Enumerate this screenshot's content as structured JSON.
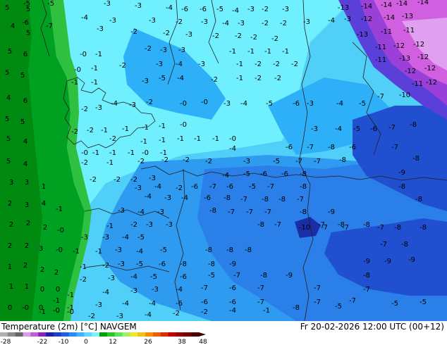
{
  "footer": {
    "title": "Temperature (2m) [°C] NAVGEM",
    "date": "Fr 20-02-2026 12:00 UTC (00+12)"
  },
  "scale": {
    "labels": [
      "-28",
      "-22",
      "-10",
      "0",
      "12",
      "26",
      "38",
      "48"
    ],
    "colors": [
      "#b0b0b0",
      "#8a8a8a",
      "#666666",
      "#d8a0e0",
      "#c060d0",
      "#9020b0",
      "#2020a0",
      "#2040c0",
      "#2060e0",
      "#2a8af0",
      "#40b0ff",
      "#60d8ff",
      "#80f0ff",
      "#00a000",
      "#30c030",
      "#60e060",
      "#a0f060",
      "#e8e830",
      "#f0c020",
      "#f09000",
      "#e86000",
      "#d83000",
      "#c00000",
      "#900000",
      "#700000",
      "#500000"
    ]
  },
  "map": {
    "labels": [
      {
        "t": "-5"
      },
      {
        "t": "-5"
      },
      {
        "t": "-3"
      },
      {
        "t": "-3"
      },
      {
        "t": "-4"
      },
      {
        "t": "-6"
      },
      {
        "t": "-6"
      },
      {
        "t": "-5"
      },
      {
        "t": "-4"
      },
      {
        "t": "-3"
      },
      {
        "t": "-2"
      },
      {
        "t": "-3"
      },
      {
        "t": "-13"
      },
      {
        "t": "-14"
      },
      {
        "t": "-14"
      },
      {
        "t": "-14"
      },
      {
        "t": "-14"
      },
      {
        "t": "-6"
      },
      {
        "t": "-4"
      },
      {
        "t": "-3"
      },
      {
        "t": "-3"
      },
      {
        "t": "-2"
      },
      {
        "t": "-3"
      },
      {
        "t": "-4"
      },
      {
        "t": "-3"
      },
      {
        "t": "-2"
      },
      {
        "t": "-2"
      },
      {
        "t": "-3"
      },
      {
        "t": "-4"
      },
      {
        "t": "-3"
      },
      {
        "t": "-12"
      },
      {
        "t": "-14"
      },
      {
        "t": "-13"
      },
      {
        "t": "-7"
      },
      {
        "t": "-3"
      },
      {
        "t": "-2"
      },
      {
        "t": "-2"
      },
      {
        "t": "-3"
      },
      {
        "t": "-2"
      },
      {
        "t": "-2"
      },
      {
        "t": "-2"
      },
      {
        "t": "-2"
      },
      {
        "t": "-13"
      },
      {
        "t": "-11"
      },
      {
        "t": "-11"
      },
      {
        "t": "-0"
      },
      {
        "t": "-1"
      },
      {
        "t": "-2"
      },
      {
        "t": "-3"
      },
      {
        "t": "-3"
      },
      {
        "t": "-1"
      },
      {
        "t": "-1"
      },
      {
        "t": "-1"
      },
      {
        "t": "-1"
      },
      {
        "t": "-11"
      },
      {
        "t": "-12"
      },
      {
        "t": "-12"
      },
      {
        "t": "-0"
      },
      {
        "t": "-1"
      },
      {
        "t": "-2"
      },
      {
        "t": "-3"
      },
      {
        "t": "-4"
      },
      {
        "t": "-3"
      },
      {
        "t": "-1"
      },
      {
        "t": "-2"
      },
      {
        "t": "-2"
      },
      {
        "t": "-2"
      },
      {
        "t": "-11"
      },
      {
        "t": "-13"
      },
      {
        "t": "-12"
      },
      {
        "t": "-1"
      },
      {
        "t": "-1"
      },
      {
        "t": "-3"
      },
      {
        "t": "-5"
      },
      {
        "t": "-4"
      },
      {
        "t": "-2"
      },
      {
        "t": "-1"
      },
      {
        "t": "-2"
      },
      {
        "t": "-2"
      },
      {
        "t": "-12"
      },
      {
        "t": "-12"
      },
      {
        "t": "-2"
      },
      {
        "t": "-3"
      },
      {
        "t": "-4"
      },
      {
        "t": "-3"
      },
      {
        "t": "-2"
      },
      {
        "t": "-0"
      },
      {
        "t": "-0"
      },
      {
        "t": "-3"
      },
      {
        "t": "-4"
      },
      {
        "t": "-5"
      },
      {
        "t": "-6"
      },
      {
        "t": "-11"
      },
      {
        "t": "-12"
      },
      {
        "t": "-2"
      },
      {
        "t": "-2"
      },
      {
        "t": "-1"
      },
      {
        "t": "-1"
      },
      {
        "t": "-1"
      },
      {
        "t": "-1"
      },
      {
        "t": "-0"
      },
      {
        "t": "-3"
      },
      {
        "t": "-4"
      },
      {
        "t": "-5"
      },
      {
        "t": "-7"
      },
      {
        "t": "-10"
      },
      {
        "t": "-2"
      },
      {
        "t": "-1"
      },
      {
        "t": "-1"
      },
      {
        "t": "-1"
      },
      {
        "t": "-1"
      },
      {
        "t": "-1"
      },
      {
        "t": "-0"
      },
      {
        "t": "-3"
      },
      {
        "t": "-4"
      },
      {
        "t": "-5"
      },
      {
        "t": "-6"
      },
      {
        "t": "-7"
      },
      {
        "t": "-8"
      },
      {
        "t": "-0"
      },
      {
        "t": "-1"
      },
      {
        "t": "-1"
      },
      {
        "t": "-1"
      },
      {
        "t": "-0"
      },
      {
        "t": "-1"
      },
      {
        "t": "-4"
      },
      {
        "t": "-6"
      },
      {
        "t": "-7"
      },
      {
        "t": "-8"
      },
      {
        "t": "-6"
      },
      {
        "t": "-7"
      },
      {
        "t": "-2"
      },
      {
        "t": "-1"
      },
      {
        "t": "-2"
      },
      {
        "t": "-2"
      },
      {
        "t": "-2"
      },
      {
        "t": "-2"
      },
      {
        "t": "-3"
      },
      {
        "t": "-5"
      },
      {
        "t": "-7"
      },
      {
        "t": "-7"
      },
      {
        "t": "-8"
      },
      {
        "t": "-8"
      },
      {
        "t": "-2"
      },
      {
        "t": "-2"
      },
      {
        "t": "-2"
      },
      {
        "t": "-3"
      },
      {
        "t": "-4"
      },
      {
        "t": "-5"
      },
      {
        "t": "-6"
      },
      {
        "t": "-6"
      },
      {
        "t": "-8"
      },
      {
        "t": "-9"
      },
      {
        "t": "-3"
      },
      {
        "t": "-4"
      },
      {
        "t": "-2"
      },
      {
        "t": "-6"
      },
      {
        "t": "-7"
      },
      {
        "t": "-6"
      },
      {
        "t": "-5"
      },
      {
        "t": "-7"
      },
      {
        "t": "-8"
      },
      {
        "t": "-8"
      },
      {
        "t": "-4"
      },
      {
        "t": "-3"
      },
      {
        "t": "-4"
      },
      {
        "t": "-6"
      },
      {
        "t": "-8"
      },
      {
        "t": "-7"
      },
      {
        "t": "-8"
      },
      {
        "t": "-8"
      },
      {
        "t": "-7"
      },
      {
        "t": "-8"
      },
      {
        "t": "-3"
      },
      {
        "t": "-4"
      },
      {
        "t": "-3"
      },
      {
        "t": "-8"
      },
      {
        "t": "-7"
      },
      {
        "t": "-7"
      },
      {
        "t": "-7"
      },
      {
        "t": "-8"
      },
      {
        "t": "-9"
      },
      {
        "t": "-1"
      },
      {
        "t": "-2"
      },
      {
        "t": "-3"
      },
      {
        "t": "-3"
      },
      {
        "t": "-8"
      },
      {
        "t": "-7"
      },
      {
        "t": "-7"
      },
      {
        "t": "-8"
      },
      {
        "t": "-8"
      },
      {
        "t": "-3"
      },
      {
        "t": "-3"
      },
      {
        "t": "-4"
      },
      {
        "t": "-5"
      },
      {
        "t": "-10"
      },
      {
        "t": "-7"
      },
      {
        "t": "-7"
      },
      {
        "t": "-7"
      },
      {
        "t": "-8"
      },
      {
        "t": "-8"
      },
      {
        "t": "-1"
      },
      {
        "t": "-1"
      },
      {
        "t": "-3"
      },
      {
        "t": "-4"
      },
      {
        "t": "-5"
      },
      {
        "t": "-8"
      },
      {
        "t": "-8"
      },
      {
        "t": "-8"
      },
      {
        "t": "-7"
      },
      {
        "t": "-8"
      },
      {
        "t": "-1"
      },
      {
        "t": "-2"
      },
      {
        "t": "-3"
      },
      {
        "t": "-5"
      },
      {
        "t": "-6"
      },
      {
        "t": "-8"
      },
      {
        "t": "-8"
      },
      {
        "t": "-9"
      },
      {
        "t": "-9"
      },
      {
        "t": "-9"
      },
      {
        "t": "-9"
      },
      {
        "t": "-2"
      },
      {
        "t": "-3"
      },
      {
        "t": "-4"
      },
      {
        "t": "-5"
      },
      {
        "t": "-6"
      },
      {
        "t": "-5"
      },
      {
        "t": "-7"
      },
      {
        "t": "-8"
      },
      {
        "t": "-9"
      },
      {
        "t": "-8"
      },
      {
        "t": "-1"
      },
      {
        "t": "-4"
      },
      {
        "t": "-3"
      },
      {
        "t": "-3"
      },
      {
        "t": "-4"
      },
      {
        "t": "-7"
      },
      {
        "t": "-6"
      },
      {
        "t": "-7"
      },
      {
        "t": "-7"
      },
      {
        "t": "-7"
      },
      {
        "t": "-1"
      },
      {
        "t": "-3"
      },
      {
        "t": "-4"
      },
      {
        "t": "-4"
      },
      {
        "t": "-6"
      },
      {
        "t": "-6"
      },
      {
        "t": "-6"
      },
      {
        "t": "-7"
      },
      {
        "t": "-7"
      },
      {
        "t": "-7"
      },
      {
        "t": "-2"
      },
      {
        "t": "-3"
      },
      {
        "t": "-4"
      },
      {
        "t": "-2"
      },
      {
        "t": "-2"
      },
      {
        "t": "-4"
      },
      {
        "t": "-1"
      },
      {
        "t": "-8"
      },
      {
        "t": "-5"
      },
      {
        "t": "-5"
      },
      {
        "t": "-5"
      },
      {
        "t": "5"
      },
      {
        "t": "5"
      },
      {
        "t": "4"
      },
      {
        "t": "5"
      },
      {
        "t": "5"
      },
      {
        "t": "6"
      },
      {
        "t": "5"
      },
      {
        "t": "5"
      },
      {
        "t": "4"
      },
      {
        "t": "6"
      },
      {
        "t": "5"
      },
      {
        "t": "5"
      },
      {
        "t": "5"
      },
      {
        "t": "4"
      },
      {
        "t": "5"
      },
      {
        "t": "4"
      },
      {
        "t": "3"
      },
      {
        "t": "3"
      },
      {
        "t": "1"
      },
      {
        "t": "2"
      },
      {
        "t": "3"
      },
      {
        "t": "4"
      },
      {
        "t": "2"
      },
      {
        "t": "2"
      },
      {
        "t": "2"
      },
      {
        "t": "2"
      },
      {
        "t": "2"
      },
      {
        "t": "3"
      },
      {
        "t": "1"
      },
      {
        "t": "2"
      },
      {
        "t": "2"
      },
      {
        "t": "2"
      },
      {
        "t": "1"
      },
      {
        "t": "1"
      },
      {
        "t": "0"
      },
      {
        "t": "0"
      },
      {
        "t": "0"
      },
      {
        "t": "-0"
      },
      {
        "t": "0"
      },
      {
        "t": "-0"
      },
      {
        "t": "-0"
      },
      {
        "t": "-1"
      },
      {
        "t": "-0"
      },
      {
        "t": "-0"
      },
      {
        "t": "-1"
      },
      {
        "t": "-1"
      }
    ]
  }
}
